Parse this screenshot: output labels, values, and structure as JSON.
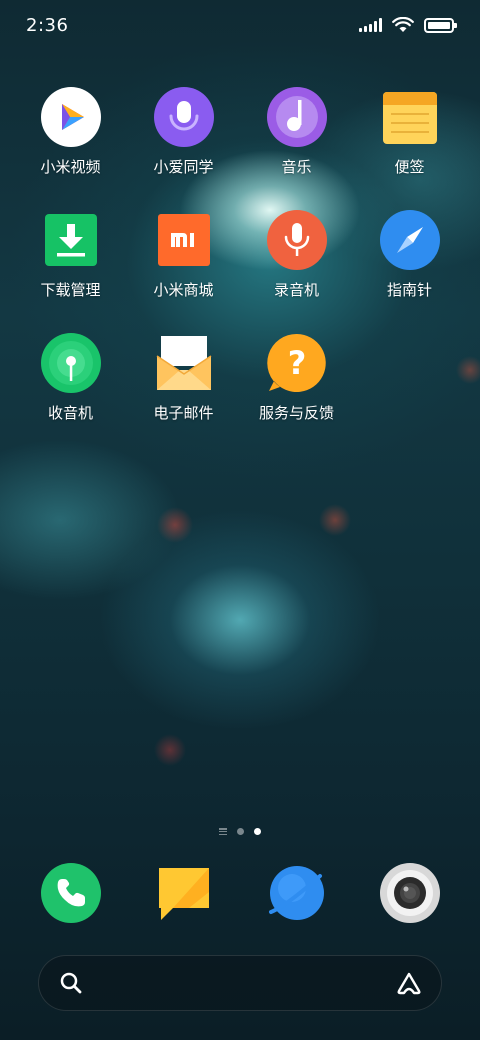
{
  "status_bar": {
    "time": "2:36",
    "icons": [
      "signal-icon",
      "wifi-icon",
      "battery-icon"
    ]
  },
  "apps": [
    {
      "label": "小米视频",
      "icon": "mi-video-icon"
    },
    {
      "label": "小爱同学",
      "icon": "xiaoai-icon"
    },
    {
      "label": "音乐",
      "icon": "music-icon"
    },
    {
      "label": "便签",
      "icon": "notes-icon"
    },
    {
      "label": "下载管理",
      "icon": "download-icon"
    },
    {
      "label": "小米商城",
      "icon": "mi-store-icon"
    },
    {
      "label": "录音机",
      "icon": "recorder-icon"
    },
    {
      "label": "指南针",
      "icon": "compass-icon"
    },
    {
      "label": "收音机",
      "icon": "radio-icon"
    },
    {
      "label": "电子邮件",
      "icon": "email-icon"
    },
    {
      "label": "服务与反馈",
      "icon": "feedback-icon"
    }
  ],
  "page_indicator": {
    "pages": 2,
    "current": 2
  },
  "dock": [
    {
      "icon": "phone-icon"
    },
    {
      "icon": "messages-icon"
    },
    {
      "icon": "browser-icon"
    },
    {
      "icon": "camera-icon"
    }
  ],
  "search_bar": {
    "icons": [
      "search-icon",
      "assistant-icon"
    ]
  },
  "colors": {
    "green": "#1fc26b",
    "purple": "#8a5cf0",
    "orange": "#f57a3a",
    "blue": "#2f8df0",
    "yellow": "#ffbc34"
  }
}
